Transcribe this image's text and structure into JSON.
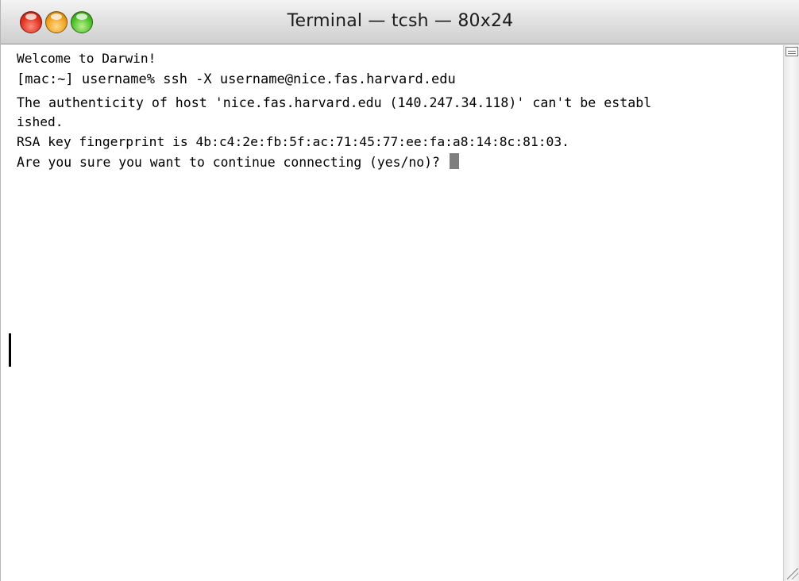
{
  "window": {
    "title": "Terminal — tcsh — 80x24"
  },
  "terminal": {
    "lines": [
      "Welcome to Darwin!",
      "[mac:~] username% ssh -X username@nice.fas.harvard.edu",
      "The authenticity of host 'nice.fas.harvard.edu (140.247.34.118)' can't be establ",
      "ished.",
      "RSA key fingerprint is 4b:c4:2e:fb:5f:ac:71:45:77:ee:fa:a8:14:8c:81:03.",
      "Are you sure you want to continue connecting (yes/no)? "
    ]
  },
  "icons": {
    "close": "close-icon",
    "minimize": "minimize-icon",
    "zoom": "zoom-icon",
    "split_view": "split-view-icon",
    "resize": "resize-grip-icon"
  },
  "colors": {
    "close": "#e0321f",
    "minimize": "#f0a21c",
    "zoom": "#4dbf2a",
    "cursor": "#7f7f7f"
  }
}
